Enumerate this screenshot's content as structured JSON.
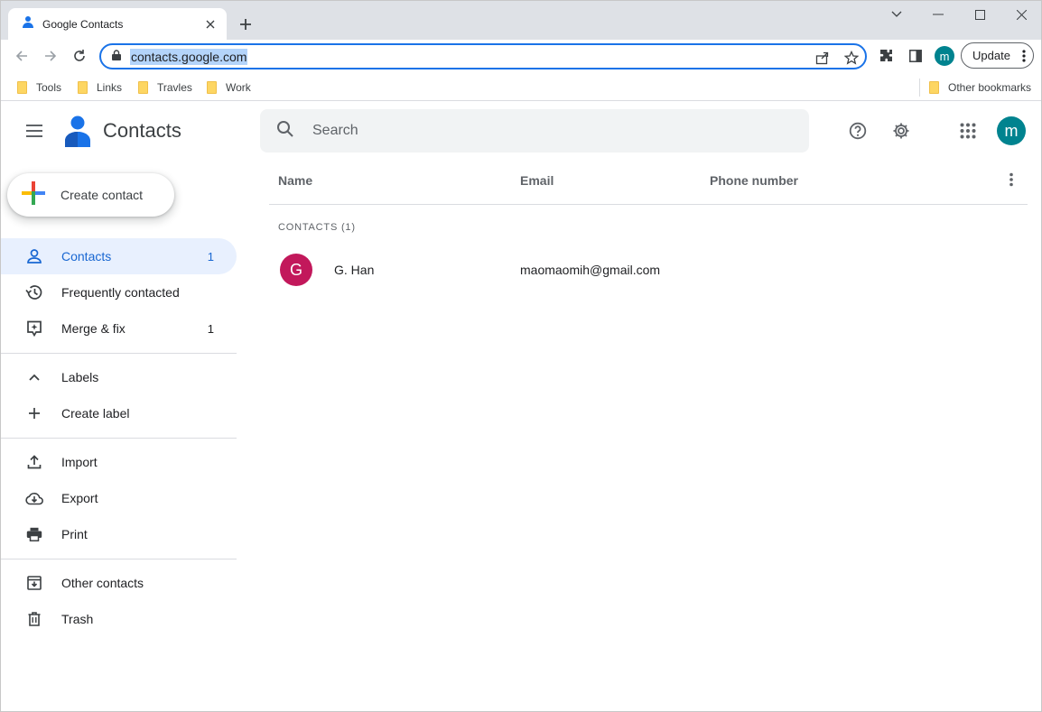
{
  "browser": {
    "tab_title": "Google Contacts",
    "url": "contacts.google.com",
    "profile_initial": "m",
    "update_label": "Update",
    "bookmarks": [
      "Tools",
      "Links",
      "Travles",
      "Work"
    ],
    "other_bookmarks": "Other bookmarks"
  },
  "app": {
    "title": "Contacts",
    "search_placeholder": "Search",
    "avatar_initial": "m",
    "create_label": "Create contact"
  },
  "nav": {
    "contacts": {
      "label": "Contacts",
      "count": "1"
    },
    "frequent": {
      "label": "Frequently contacted"
    },
    "merge": {
      "label": "Merge & fix",
      "count": "1"
    },
    "labels": {
      "label": "Labels"
    },
    "create_label": {
      "label": "Create label"
    },
    "import": {
      "label": "Import"
    },
    "export": {
      "label": "Export"
    },
    "print": {
      "label": "Print"
    },
    "other_contacts": {
      "label": "Other contacts"
    },
    "trash": {
      "label": "Trash"
    }
  },
  "table": {
    "columns": [
      "Name",
      "Email",
      "Phone number"
    ],
    "section_label": "CONTACTS (1)",
    "rows": [
      {
        "initial": "G",
        "name": "G. Han",
        "email": "maomaomih@gmail.com",
        "phone": ""
      }
    ]
  },
  "colors": {
    "accent": "#1a73e8",
    "active_bg": "#e8f0fe",
    "avatar_profile": "#00838f",
    "avatar_contact": "#c2185b"
  }
}
